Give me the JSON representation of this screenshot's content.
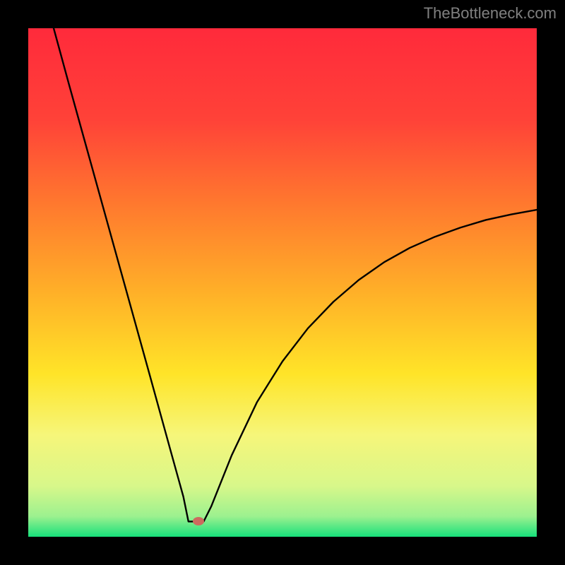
{
  "watermark": "TheBottleneck.com",
  "chart_data": {
    "type": "line",
    "title": "",
    "xlabel": "",
    "ylabel": "",
    "xlim": [
      0,
      100
    ],
    "ylim": [
      0,
      100
    ],
    "gradient": {
      "stops": [
        {
          "offset": 0.0,
          "color": "#ff2a3b"
        },
        {
          "offset": 0.18,
          "color": "#ff4238"
        },
        {
          "offset": 0.35,
          "color": "#ff7a2e"
        },
        {
          "offset": 0.52,
          "color": "#ffb028"
        },
        {
          "offset": 0.68,
          "color": "#ffe428"
        },
        {
          "offset": 0.8,
          "color": "#f6f67a"
        },
        {
          "offset": 0.9,
          "color": "#d8f78a"
        },
        {
          "offset": 0.96,
          "color": "#9cf18f"
        },
        {
          "offset": 1.0,
          "color": "#17e07b"
        }
      ]
    },
    "series": [
      {
        "name": "bottleneck-curve",
        "x": [
          5.0,
          8.0,
          12.0,
          16.0,
          20.0,
          24.0,
          28.0,
          30.5,
          31.5,
          33.0,
          34.5,
          36.0,
          40.0,
          45.0,
          50.0,
          55.0,
          60.0,
          65.0,
          70.0,
          75.0,
          80.0,
          85.0,
          90.0,
          95.0,
          100.0
        ],
        "y": [
          100.0,
          89.0,
          74.6,
          60.2,
          45.8,
          31.4,
          16.9,
          7.9,
          3.0,
          3.0,
          3.0,
          6.0,
          16.0,
          26.5,
          34.5,
          41.0,
          46.2,
          50.5,
          54.0,
          56.8,
          59.0,
          60.8,
          62.3,
          63.4,
          64.3
        ]
      }
    ],
    "marker": {
      "name": "optimal-point",
      "x": 33.5,
      "y": 3.0,
      "color": "#cd6a5e"
    }
  }
}
